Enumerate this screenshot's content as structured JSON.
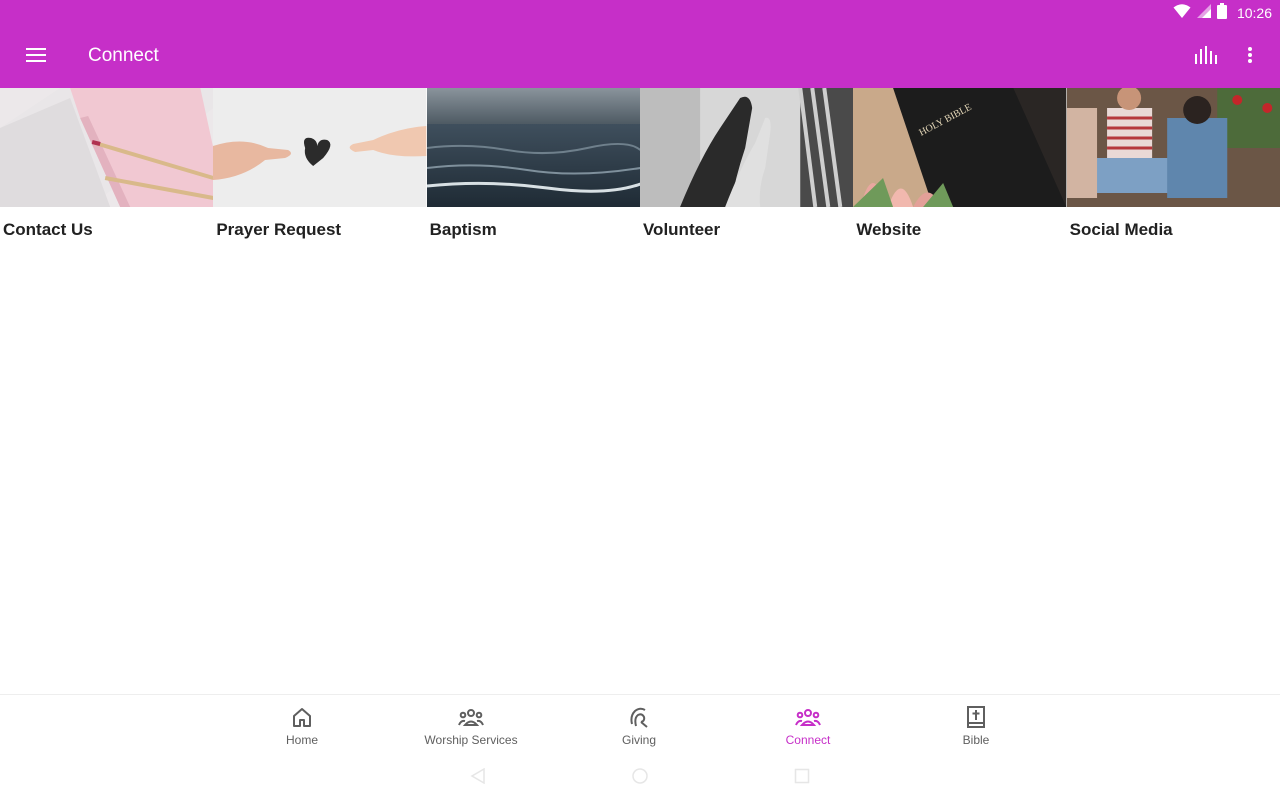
{
  "status_bar": {
    "time": "10:26",
    "icons": [
      "wifi-icon",
      "signal-icon",
      "battery-icon"
    ]
  },
  "app_bar": {
    "title": "Connect",
    "left_icon": "menu-icon",
    "actions": [
      "stats-icon",
      "more-vert-icon"
    ]
  },
  "tiles": [
    {
      "label": "Contact Us",
      "image": "journal-pencils-photo"
    },
    {
      "label": "Prayer Request",
      "image": "hands-heart-photo"
    },
    {
      "label": "Baptism",
      "image": "ocean-water-photo"
    },
    {
      "label": "Volunteer",
      "image": "holding-hands-photo"
    },
    {
      "label": "Website",
      "image": "holy-bible-tulips-photo"
    },
    {
      "label": "Social Media",
      "image": "friends-sitting-photo"
    }
  ],
  "bottom_nav": {
    "active": "Connect",
    "items": [
      {
        "label": "Home",
        "icon": "home-icon"
      },
      {
        "label": "Worship Services",
        "icon": "people-group-icon"
      },
      {
        "label": "Giving",
        "icon": "giving-hand-icon"
      },
      {
        "label": "Connect",
        "icon": "people-group-icon"
      },
      {
        "label": "Bible",
        "icon": "bible-book-icon"
      }
    ]
  },
  "colors": {
    "primary": "#c62fc8",
    "nav_inactive": "#5f5f5f",
    "text": "#212121"
  },
  "system_nav": [
    "back-icon",
    "home-circle-icon",
    "recents-square-icon"
  ]
}
